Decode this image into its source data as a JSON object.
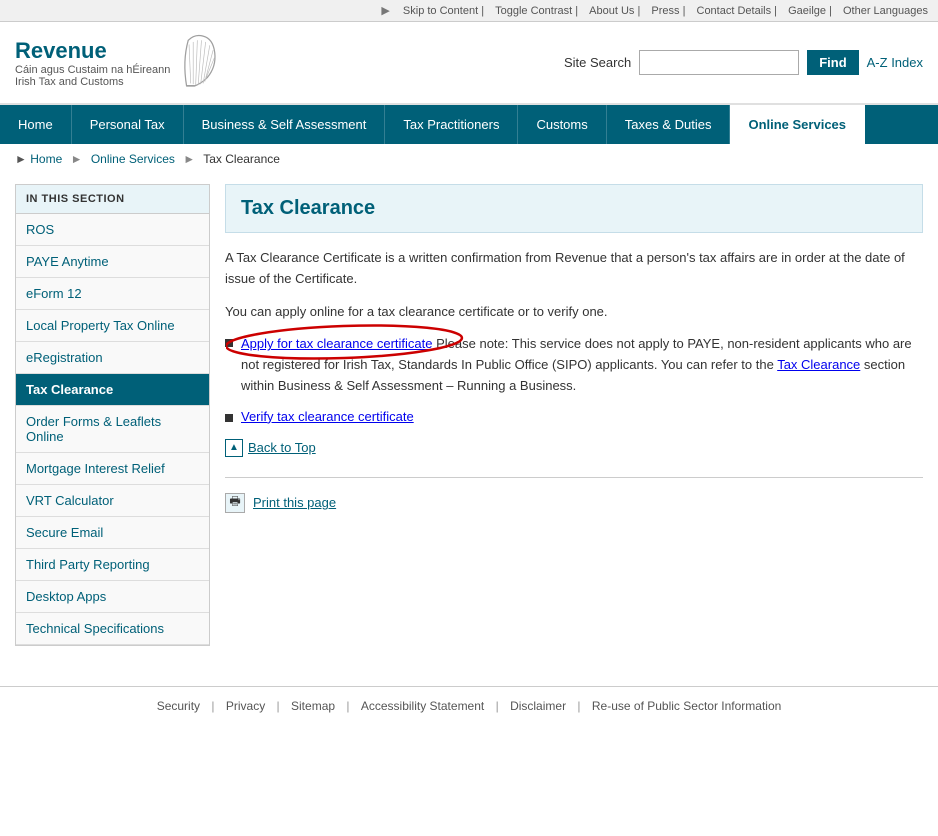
{
  "utility": {
    "skip": "Skip to Content",
    "toggle_contrast": "Toggle Contrast",
    "about_us": "About Us",
    "press": "Press",
    "contact_details": "Contact Details",
    "gaeilge": "Gaeilge",
    "other_languages": "Other Languages"
  },
  "header": {
    "logo_title": "Revenue",
    "logo_subtitle": "Cáin agus Custaim na hÉireann",
    "logo_subtitle_en": "Irish Tax and Customs",
    "search_label": "Site Search",
    "search_placeholder": "",
    "find_btn": "Find",
    "az_index": "A-Z Index"
  },
  "nav": {
    "items": [
      {
        "label": "Home",
        "active": false
      },
      {
        "label": "Personal Tax",
        "active": false
      },
      {
        "label": "Business & Self Assessment",
        "active": false
      },
      {
        "label": "Tax Practitioners",
        "active": false
      },
      {
        "label": "Customs",
        "active": false
      },
      {
        "label": "Taxes & Duties",
        "active": false
      },
      {
        "label": "Online Services",
        "active": true
      }
    ]
  },
  "breadcrumb": {
    "home": "Home",
    "online_services": "Online Services",
    "current": "Tax Clearance"
  },
  "sidebar": {
    "section_header": "IN THIS SECTION",
    "items": [
      {
        "label": "ROS",
        "active": false
      },
      {
        "label": "PAYE Anytime",
        "active": false
      },
      {
        "label": "eForm 12",
        "active": false
      },
      {
        "label": "Local Property Tax Online",
        "active": false
      },
      {
        "label": "eRegistration",
        "active": false
      },
      {
        "label": "Tax Clearance",
        "active": true
      },
      {
        "label": "Order Forms & Leaflets Online",
        "active": false
      },
      {
        "label": "Mortgage Interest Relief",
        "active": false
      },
      {
        "label": "VRT Calculator",
        "active": false
      },
      {
        "label": "Secure Email",
        "active": false
      },
      {
        "label": "Third Party Reporting",
        "active": false
      },
      {
        "label": "Desktop Apps",
        "active": false
      },
      {
        "label": "Technical Specifications",
        "active": false
      }
    ]
  },
  "main": {
    "page_title": "Tax Clearance",
    "intro1": "A Tax Clearance Certificate is a written confirmation from Revenue that a person's tax affairs are in order at the date of issue of the Certificate.",
    "intro2": "You can apply online for a tax clearance certificate or to verify one.",
    "link1_text": "Apply for tax clearance certificate",
    "link1_note": " Please note: This service does not apply to PAYE, non-resident applicants who are not registered for Irish Tax, Standards In Public Office (SIPO) applicants. You can refer to the ",
    "link1_note_link": "Tax Clearance",
    "link1_note2": " section within Business & Self Assessment – Running a Business.",
    "link2_text": "Verify tax clearance certificate",
    "back_to_top": "Back to Top",
    "print_label": "Print this page"
  },
  "footer": {
    "items": [
      "Security",
      "Privacy",
      "Sitemap",
      "Accessibility Statement",
      "Disclaimer",
      "Re-use of Public Sector Information"
    ]
  }
}
